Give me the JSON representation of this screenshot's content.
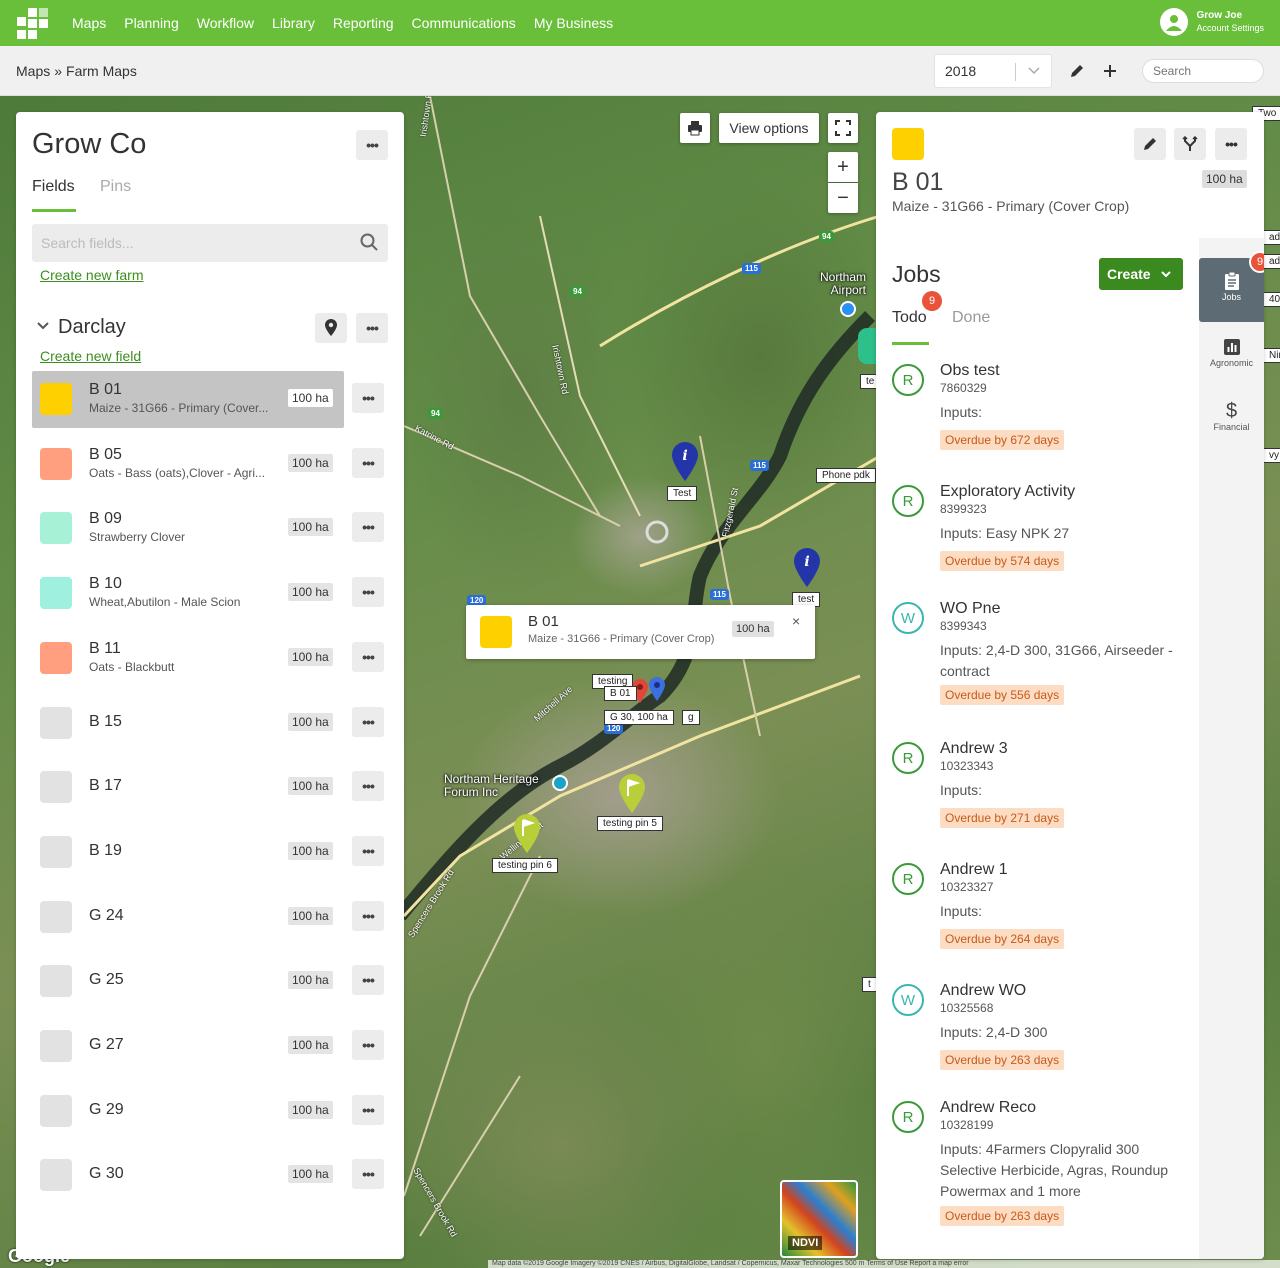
{
  "nav": {
    "items": [
      "Maps",
      "Planning",
      "Workflow",
      "Library",
      "Reporting",
      "Communications",
      "My Business"
    ],
    "account_name": "Grow Joe",
    "account_settings": "Account Settings",
    "brand_color": "#6abf3a"
  },
  "breadcrumb": {
    "root": "Maps",
    "sep": "»",
    "current": "Farm Maps"
  },
  "toolbar": {
    "year": "2018",
    "search_placeholder": "Search"
  },
  "map": {
    "view_options": "View options",
    "zoom_in": "+",
    "zoom_out": "−",
    "google": "Google",
    "ndvi": "NDVI",
    "attribution": "Map data ©2019 Google Imagery ©2019 CNES / Airbus, DigitalGlobe, Landsat / Copernicus, Maxar Technologies   500 m   Terms of Use   Report a map error",
    "places": {
      "airport": "Northam\nAirport",
      "heritage": "Northam Heritage\nForum Inc"
    },
    "roads": [
      "Irishtown Rd",
      "Irishtown Rd",
      "Katrine Rd",
      "Mitchell Ave",
      "Wellington St",
      "Spencers Brook Rd",
      "Spencers Brook Rd",
      "Fitzgerald St"
    ],
    "pin_labels": [
      "Test",
      "test",
      "testing",
      "B 01",
      "G 30, 100 ha",
      "g",
      "testing pin 5",
      "testing pin 6",
      "Phone pdk",
      "te",
      "t",
      "Two",
      "ado",
      "ad",
      "40",
      "Nin",
      "vy"
    ],
    "popup": {
      "title": "B 01",
      "subtitle": "Maize - 31G66 - Primary (Cover Crop)",
      "area": "100 ha",
      "close": "×"
    }
  },
  "left_panel": {
    "title": "Grow Co",
    "tabs": [
      "Fields",
      "Pins"
    ],
    "search_placeholder": "Search fields...",
    "create_farm": "Create new farm",
    "farm_name": "Darclay",
    "create_field": "Create new field",
    "fields": [
      {
        "name": "B 01",
        "sub": "Maize - 31G66 - Primary (Cover...",
        "area": "100 ha",
        "color": "#ffd000",
        "selected": true
      },
      {
        "name": "B 05",
        "sub": "Oats - Bass (oats),Clover - Agri...",
        "area": "100 ha",
        "color": "#ff9f80"
      },
      {
        "name": "B 09",
        "sub": "Strawberry Clover",
        "area": "100 ha",
        "color": "#a7f2d6"
      },
      {
        "name": "B 10",
        "sub": "Wheat,Abutilon - Male Scion",
        "area": "100 ha",
        "color": "#a0f0e0"
      },
      {
        "name": "B 11",
        "sub": "Oats - Blackbutt",
        "area": "100 ha",
        "color": "#ff9f80"
      },
      {
        "name": "B 15",
        "sub": "",
        "area": "100 ha",
        "color": "#e2e2e2"
      },
      {
        "name": "B 17",
        "sub": "",
        "area": "100 ha",
        "color": "#e2e2e2"
      },
      {
        "name": "B 19",
        "sub": "",
        "area": "100 ha",
        "color": "#e2e2e2"
      },
      {
        "name": "G 24",
        "sub": "",
        "area": "100 ha",
        "color": "#e2e2e2"
      },
      {
        "name": "G 25",
        "sub": "",
        "area": "100 ha",
        "color": "#e2e2e2"
      },
      {
        "name": "G 27",
        "sub": "",
        "area": "100 ha",
        "color": "#e2e2e2"
      },
      {
        "name": "G 29",
        "sub": "",
        "area": "100 ha",
        "color": "#e2e2e2"
      },
      {
        "name": "G 30",
        "sub": "",
        "area": "100 ha",
        "color": "#e2e2e2"
      }
    ]
  },
  "right_panel": {
    "field_name": "B 01",
    "field_sub": "Maize - 31G66 - Primary (Cover Crop)",
    "area": "100 ha",
    "color": "#ffd000",
    "jobs_title": "Jobs",
    "create_label": "Create",
    "tabs": [
      "Todo",
      "Done"
    ],
    "todo_count": "9",
    "sidebar": [
      {
        "label": "Jobs",
        "icon": "clipboard-icon",
        "badge": "9"
      },
      {
        "label": "Agronomic",
        "icon": "bar-chart-icon"
      },
      {
        "label": "Financial",
        "icon": "dollar-icon"
      }
    ],
    "jobs": [
      {
        "type": "R",
        "name": "Obs test",
        "id": "7860329",
        "inputs": "Inputs:",
        "overdue": "Overdue by 672 days"
      },
      {
        "type": "R",
        "name": "Exploratory Activity",
        "id": "8399323",
        "inputs": "Inputs: Easy NPK 27",
        "overdue": "Overdue by 574 days"
      },
      {
        "type": "W",
        "name": "WO Pne",
        "id": "8399343",
        "inputs": "Inputs: 2,4-D 300, 31G66, Airseeder - contract",
        "overdue": "Overdue by 556 days"
      },
      {
        "type": "R",
        "name": "Andrew 3",
        "id": "10323343",
        "inputs": "Inputs:",
        "overdue": "Overdue by 271 days"
      },
      {
        "type": "R",
        "name": "Andrew 1",
        "id": "10323327",
        "inputs": "Inputs:",
        "overdue": "Overdue by 264 days"
      },
      {
        "type": "W",
        "name": "Andrew WO",
        "id": "10325568",
        "inputs": "Inputs: 2,4-D 300",
        "overdue": "Overdue by 263 days"
      },
      {
        "type": "R",
        "name": "Andrew Reco",
        "id": "10328199",
        "inputs": "Inputs: 4Farmers Clopyralid 300 Selective Herbicide, Agras, Roundup Powermax and 1 more",
        "overdue": "Overdue by 263 days"
      }
    ]
  }
}
